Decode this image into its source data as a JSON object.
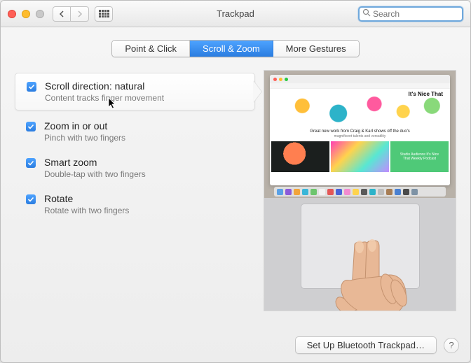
{
  "window": {
    "title": "Trackpad",
    "search_placeholder": "Search"
  },
  "tabs": [
    {
      "label": "Point & Click"
    },
    {
      "label": "Scroll & Zoom"
    },
    {
      "label": "More Gestures"
    }
  ],
  "options": [
    {
      "title": "Scroll direction: natural",
      "subtitle": "Content tracks finger movement",
      "checked": true,
      "active": true
    },
    {
      "title": "Zoom in or out",
      "subtitle": "Pinch with two fingers",
      "checked": true,
      "active": false
    },
    {
      "title": "Smart zoom",
      "subtitle": "Double-tap with two fingers",
      "checked": true,
      "active": false
    },
    {
      "title": "Rotate",
      "subtitle": "Rotate with two fingers",
      "checked": true,
      "active": false
    }
  ],
  "preview": {
    "site_title": "It's Nice That",
    "tagline1": "Great new work from Craig & Karl shows off the duo's",
    "tagline2": "magnificent talents and versatility",
    "badge": "Studio Audience It's Nice That Weekly Podcast"
  },
  "footer": {
    "setup_button": "Set Up Bluetooth Trackpad…",
    "help_label": "?"
  }
}
